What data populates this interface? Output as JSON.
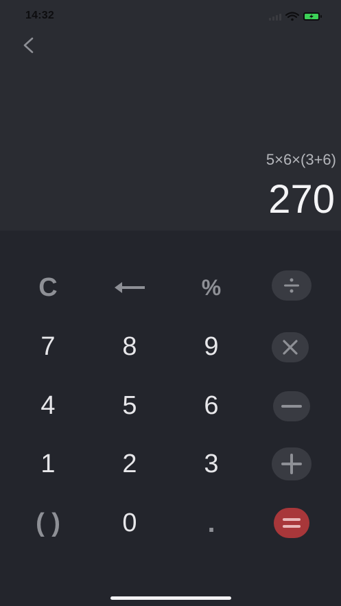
{
  "status_bar": {
    "time": "14:32",
    "battery_color": "#3cd157"
  },
  "display": {
    "expression": "5×6×(3+6)",
    "result": "270"
  },
  "keys": {
    "clear": "C",
    "percent": "%",
    "seven": "7",
    "eight": "8",
    "nine": "9",
    "four": "4",
    "five": "5",
    "six": "6",
    "one": "1",
    "two": "2",
    "three": "3",
    "parentheses": "( )",
    "zero": "0",
    "decimal": "."
  },
  "icons": {
    "back": "chevron-left-icon",
    "backspace": "arrow-left-icon",
    "divide": "divide-icon",
    "multiply": "multiply-icon",
    "subtract": "minus-icon",
    "add": "plus-icon",
    "equals": "equals-icon"
  },
  "colors": {
    "display_bg": "#2a2c32",
    "keypad_bg": "#23252c",
    "operator_bg": "#393b42",
    "equals_bg": "#a8373a"
  }
}
